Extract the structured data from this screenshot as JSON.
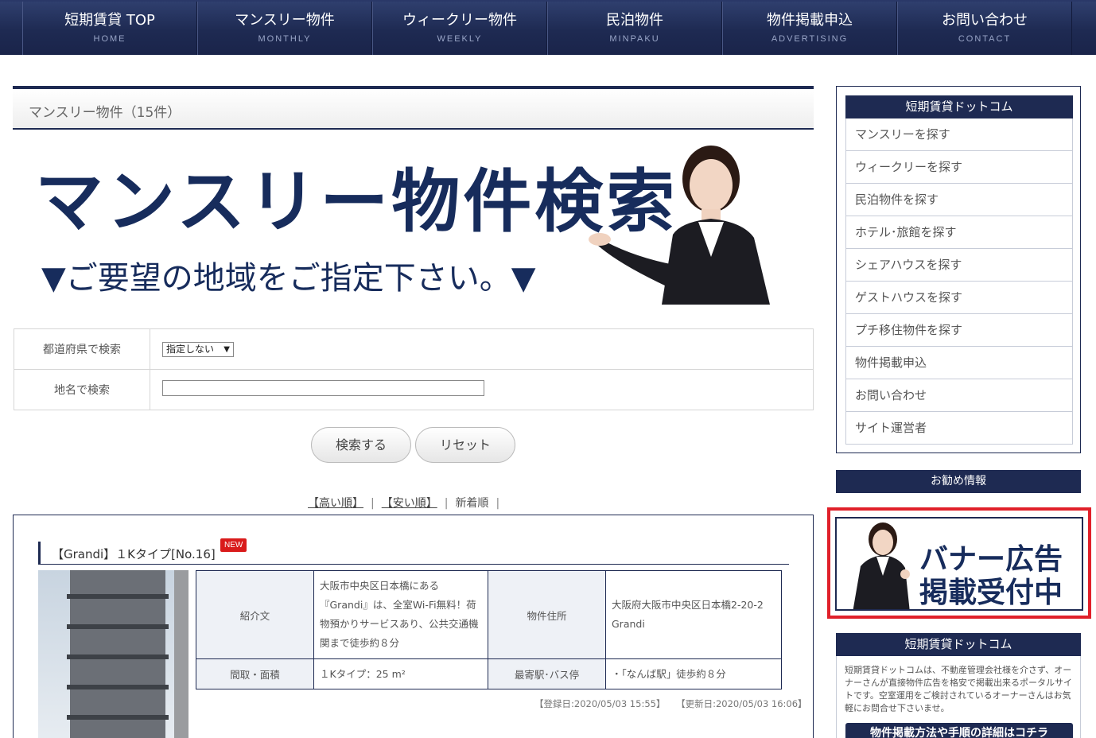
{
  "nav": [
    {
      "jp": "短期賃貸 TOP",
      "en": "HOME"
    },
    {
      "jp": "マンスリー物件",
      "en": "MONTHLY"
    },
    {
      "jp": "ウィークリー物件",
      "en": "WEEKLY"
    },
    {
      "jp": "民泊物件",
      "en": "MINPAKU"
    },
    {
      "jp": "物件掲載申込",
      "en": "ADVERTISING"
    },
    {
      "jp": "お問い合わせ",
      "en": "CONTACT"
    }
  ],
  "page_title": "マンスリー物件（15件）",
  "hero": {
    "title": "マンスリー物件検索",
    "subtitle": "▼ご要望の地域をご指定下さい。▼"
  },
  "search": {
    "pref_label": "都道府県で検索",
    "pref_value": "指定しない",
    "place_label": "地名で検索",
    "place_value": "",
    "submit_label": "検索する",
    "reset_label": "リセット"
  },
  "sort": {
    "high": "【高い順】",
    "low": "【安い順】",
    "new": "新着順",
    "sep": "|"
  },
  "listing": {
    "title": "【Grandi】１Kタイプ[No.16]",
    "badge": "NEW",
    "intro_label": "紹介文",
    "intro_text": "大阪市中央区日本橋にある『Grandi』は、全室Wi-Fi無料！荷物預かりサービスあり、公共交通機関まで徒歩約８分",
    "address_label": "物件住所",
    "address_text": "大阪府大阪市中央区日本橋2-20-2 Grandi",
    "layout_label": "間取・面積",
    "layout_text": "１Kタイプ：25 m²",
    "station_label": "最寄駅･バス停",
    "station_text": "・「なんば駅」徒歩約８分",
    "registered": "【登録日:2020/05/03 15:55】",
    "updated": "【更新日:2020/05/03 16:06】"
  },
  "sidebar": {
    "head": "短期賃貸ドットコム",
    "items": [
      "マンスリーを探す",
      "ウィークリーを探す",
      "民泊物件を探す",
      "ホテル･旅館を探す",
      "シェアハウスを探す",
      "ゲストハウスを探す",
      "プチ移住物件を探す",
      "物件掲載申込",
      "お問い合わせ",
      "サイト運営者"
    ],
    "recommend_head": "お勧め情報",
    "banner_line1": "バナー広告",
    "banner_line2": "掲載受付中",
    "about_head": "短期賃貸ドットコム",
    "about_text": "短期賃貸ドットコムは、不動産管理会社様を介さず、オーナーさんが直接物件広告を格安で掲載出来るポータルサイトです。空室運用をご検討されているオーナーさんはお気軽にお問合せ下さいませ。",
    "about_button": "物件掲載方法や手順の詳細はコチラ"
  },
  "colors": {
    "navy": "#1e2a52",
    "hero_text": "#172c5c",
    "badge_red": "#d91b1b",
    "banner_border": "#e0202a"
  }
}
